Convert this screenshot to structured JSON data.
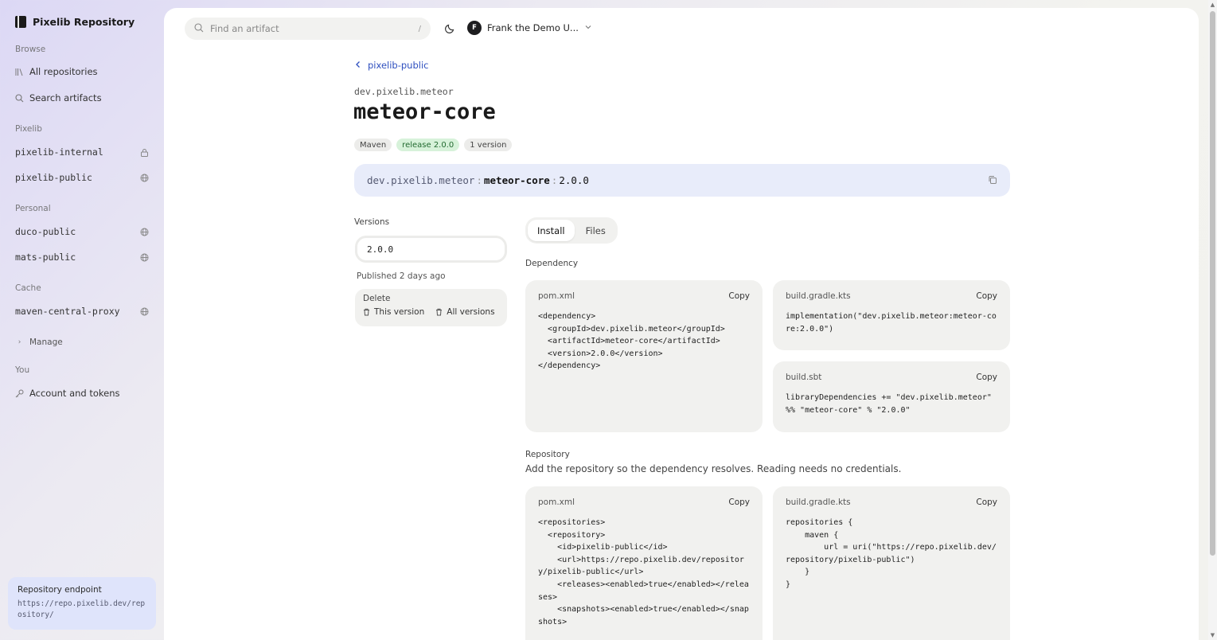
{
  "brand": {
    "name": "Pixelib Repository"
  },
  "sidebar": {
    "browse_label": "Browse",
    "browse_items": [
      {
        "label": "All repositories",
        "icon": "library-icon"
      },
      {
        "label": "Search artifacts",
        "icon": "search-icon"
      }
    ],
    "pixelib_label": "Pixelib",
    "pixelib_repos": [
      {
        "name": "pixelib-internal",
        "icon": "lock-icon"
      },
      {
        "name": "pixelib-public",
        "icon": "globe-icon"
      }
    ],
    "personal_label": "Personal",
    "personal_repos": [
      {
        "name": "duco-public",
        "icon": "globe-icon"
      },
      {
        "name": "mats-public",
        "icon": "globe-icon"
      }
    ],
    "cache_label": "Cache",
    "cache_repos": [
      {
        "name": "maven-central-proxy",
        "icon": "globe-icon"
      }
    ],
    "manage_label": "Manage",
    "you_label": "You",
    "account_label": "Account and tokens",
    "endpoint": {
      "title": "Repository endpoint",
      "url": "https://repo.pixelib.dev/repository/"
    }
  },
  "header": {
    "search_placeholder": "Find an artifact",
    "search_shortcut": "/",
    "user_initial": "F",
    "user_name": "Frank the Demo U..."
  },
  "artifact": {
    "back_label": "pixelib-public",
    "group": "dev.pixelib.meteor",
    "name": "meteor-core",
    "badges": {
      "format": "Maven",
      "release": "release 2.0.0",
      "count": "1 version"
    },
    "coordinate": {
      "group": "dev.pixelib.meteor",
      "sep1": ":",
      "artifact": "meteor-core",
      "sep2": ":",
      "version": "2.0.0"
    }
  },
  "versions": {
    "label": "Versions",
    "selected": "2.0.0",
    "published": "Published 2 days ago",
    "delete_label": "Delete",
    "delete_this": "This version",
    "delete_all": "All versions"
  },
  "tabs": {
    "install": "Install",
    "files": "Files"
  },
  "dependency": {
    "label": "Dependency",
    "copy": "Copy",
    "pom_title": "pom.xml",
    "pom_code": "<dependency>\n  <groupId>dev.pixelib.meteor</groupId>\n  <artifactId>meteor-core</artifactId>\n  <version>2.0.0</version>\n</dependency>",
    "gradle_title": "build.gradle.kts",
    "gradle_code": "implementation(\"dev.pixelib.meteor:meteor-core:2.0.0\")",
    "sbt_title": "build.sbt",
    "sbt_code": "libraryDependencies += \"dev.pixelib.meteor\" %% \"meteor-core\" % \"2.0.0\""
  },
  "repository": {
    "label": "Repository",
    "description": "Add the repository so the dependency resolves. Reading needs no credentials.",
    "copy": "Copy",
    "pom_title": "pom.xml",
    "pom_code": "<repositories>\n  <repository>\n    <id>pixelib-public</id>\n    <url>https://repo.pixelib.dev/repository/pixelib-public</url>\n    <releases><enabled>true</enabled></releases>\n    <snapshots><enabled>true</enabled></snapshots>",
    "gradle_title": "build.gradle.kts",
    "gradle_code": "repositories {\n    maven {\n        url = uri(\"https://repo.pixelib.dev/repository/pixelib-public\")\n    }\n}"
  }
}
